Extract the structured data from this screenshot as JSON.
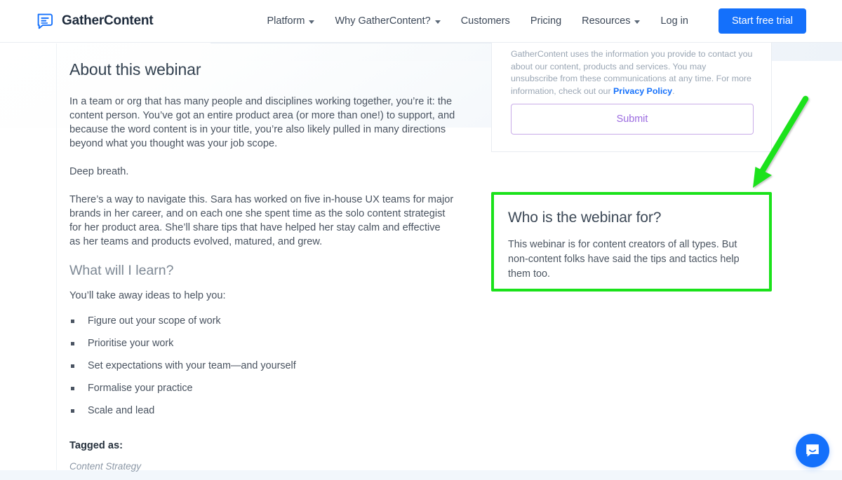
{
  "header": {
    "brand_name": "GatherContent",
    "brand_icon": "document-lines-icon",
    "nav": [
      {
        "label": "Platform",
        "has_caret": true
      },
      {
        "label": "Why GatherContent?",
        "has_caret": true
      },
      {
        "label": "Customers",
        "has_caret": false
      },
      {
        "label": "Pricing",
        "has_caret": false
      },
      {
        "label": "Resources",
        "has_caret": true
      },
      {
        "label": "Log in",
        "has_caret": false
      }
    ],
    "cta_label": "Start free trial",
    "cta_color": "#1470fb"
  },
  "article": {
    "title": "About this webinar",
    "p1": "In a team or org that has many people and disciplines working together, you’re it: the content person. You’ve got an entire product area (or more than one!) to support, and because the word content is in your title, you’re also likely pulled in many directions beyond what you thought was your job scope.",
    "p2": "Deep breath.",
    "p3": "There’s a way to navigate this. Sara has worked on five in-house UX teams for major brands in her career, and on each one she spent time as the solo content strategist for her product area. She’ll share tips that have helped her stay calm and effective as her teams and products evolved, matured, and grew.",
    "learn_title": "What will I learn?",
    "learn_intro": "You’ll take away ideas to help you:",
    "bullets": [
      "Figure out your scope of work",
      "Prioritise your work",
      "Set expectations with your team—and yourself",
      "Formalise your practice",
      "Scale and lead"
    ],
    "tagged_title": "Tagged as:",
    "tag": "Content Strategy"
  },
  "form": {
    "consent_text_before": "GatherContent uses the information you provide to contact you about our content, products and services. You may unsubscribe from these communications at any time. For more information, check out our ",
    "privacy_link": "Privacy Policy",
    "consent_text_after": ".",
    "submit_label": "Submit",
    "submit_color": "#9b6ae0",
    "submit_border_color": "#c9abe8"
  },
  "who_panel": {
    "title": "Who is the webinar for?",
    "body": "This webinar is for content creators of all types. But non-content folks have said the tips and tactics help them too.",
    "highlight_color": "#1ae21a"
  },
  "annotation": {
    "arrow_color": "#1ae21a",
    "arrow_name": "green-pointer-arrow"
  },
  "chat": {
    "icon": "chat-bubble-smile-icon",
    "color": "#1470fb"
  }
}
